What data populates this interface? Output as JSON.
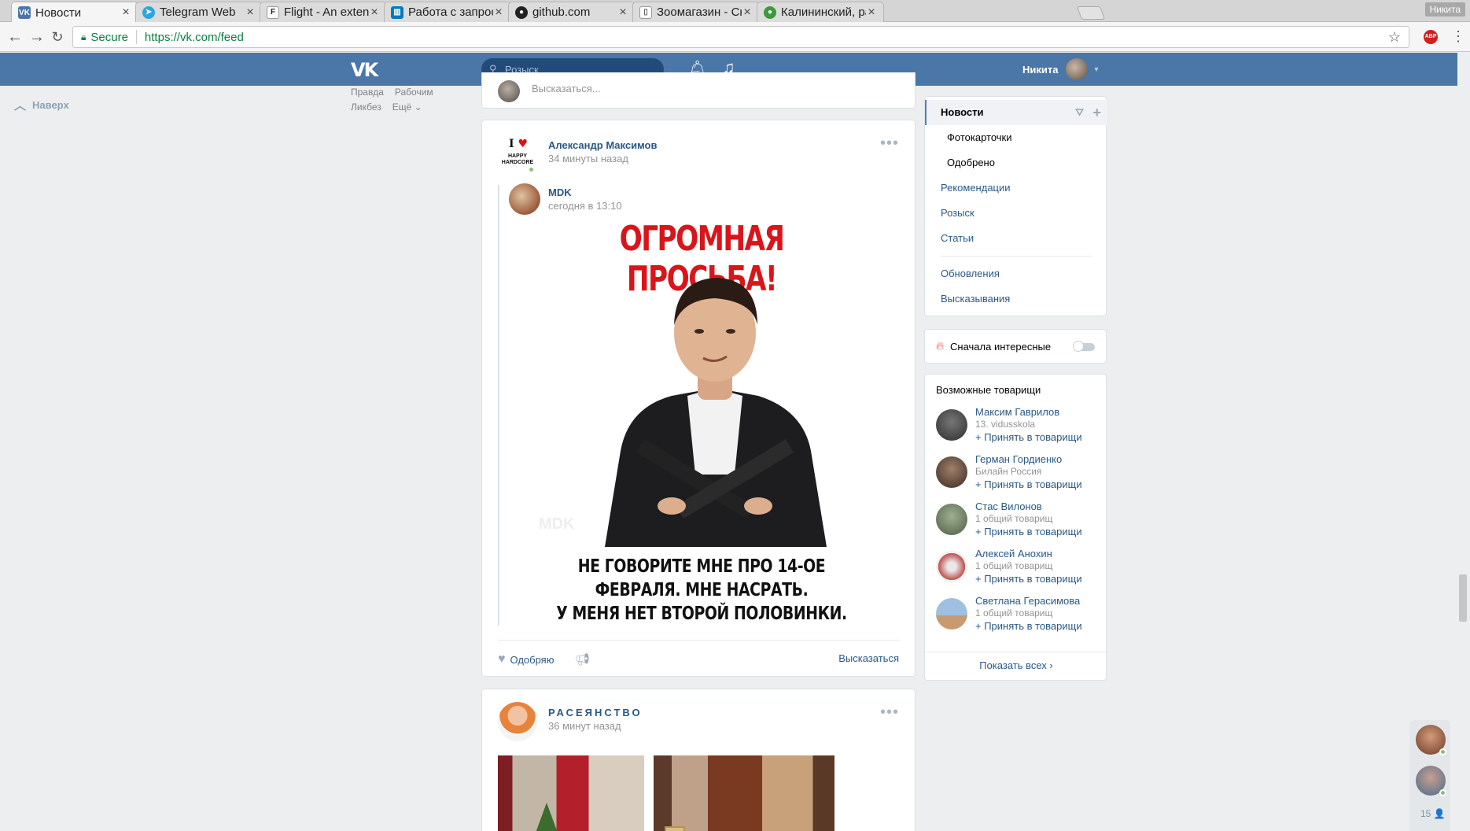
{
  "browser": {
    "tabs": [
      {
        "title": "Новости",
        "favicon": "vk-icon",
        "color": "#4a76a8",
        "glyph": "VK"
      },
      {
        "title": "Telegram Web",
        "favicon": "telegram-icon",
        "color": "#2ca5e0",
        "glyph": "➤"
      },
      {
        "title": "Flight - An extensible",
        "favicon": "flight-icon",
        "color": "#333333",
        "glyph": "F"
      },
      {
        "title": "Работа с запросами",
        "favicon": "trello-icon",
        "color": "#0079bf",
        "glyph": "▥"
      },
      {
        "title": "github.com",
        "favicon": "github-icon",
        "color": "#222222",
        "glyph": "●"
      },
      {
        "title": "Зоомагазин - Склад",
        "favicon": "document-icon",
        "color": "#9e9e9e",
        "glyph": "▯"
      },
      {
        "title": "Калининский, район",
        "favicon": "map-icon",
        "color": "#3c9a3c",
        "glyph": "●"
      }
    ],
    "profile_name": "Никита",
    "secure_label": "Secure",
    "url": "https://vk.com/feed",
    "abp_badge": "ABP"
  },
  "vk": {
    "search_placeholder": "Розыск",
    "user_name": "Никита",
    "to_top": "Наверх",
    "left_links": [
      "Правда",
      "Рабочим",
      "Ликбез",
      "Ещё ⌄"
    ],
    "comment_placeholder": "Высказаться...",
    "post1": {
      "author": "Александр Максимов",
      "time": "34 минуты назад",
      "avatar_text": "I ♥",
      "avatar_sub": "HAPPY HARDCORE",
      "repost_author": "MDK",
      "repost_time": "сегодня в 13:10",
      "image_title": "ОГРОМНАЯ ПРОСЬБА!",
      "image_caption_1": "НЕ ГОВОРИТЕ МНЕ ПРО 14-ОЕ ФЕВРАЛЯ. МНЕ НАСРАТЬ.",
      "image_caption_2": "У МЕНЯ НЕТ ВТОРОЙ ПОЛОВИНКИ.",
      "image_watermark": "MDK",
      "like_label": "Одобряю",
      "comment_label": "Высказаться"
    },
    "post2": {
      "author": "РАСЕЯНСТВО",
      "time": "36 минут назад"
    },
    "right_menu": [
      {
        "label": "Новости",
        "selected": true
      },
      {
        "label": "Фотокарточки",
        "sub": true
      },
      {
        "label": "Одобрено",
        "sub": true
      },
      {
        "label": "Рекомендации"
      },
      {
        "label": "Розыск"
      },
      {
        "label": "Статьи"
      },
      {
        "label": "Обновления"
      },
      {
        "label": "Высказывания"
      }
    ],
    "interesting_first": "Сначала интересные",
    "interesting_on": false,
    "friends_header": "Возможные товарищи",
    "friends": [
      {
        "name": "Максим Гаврилов",
        "sub": "13. vidusskola",
        "action": "+ Принять в товарищи",
        "color": "#3b3b3b"
      },
      {
        "name": "Герман Гордиенко",
        "sub": "Билайн Россия",
        "action": "+ Принять в товарищи",
        "color": "#4a3a30"
      },
      {
        "name": "Стас Вилонов",
        "sub": "1 общий товарищ",
        "action": "+ Принять в товарищи",
        "color": "#6b7e62"
      },
      {
        "name": "Алексей Анохин",
        "sub": "1 общий товарищ",
        "action": "+ Принять в товарищи",
        "color": "#c0504d"
      },
      {
        "name": "Светлана Герасимова",
        "sub": "1 общий товарищ",
        "action": "+ Принять в товарищи",
        "color": "#7fa6c8"
      }
    ],
    "show_all": "Показать всех ›",
    "chat_count": "15 👤"
  }
}
